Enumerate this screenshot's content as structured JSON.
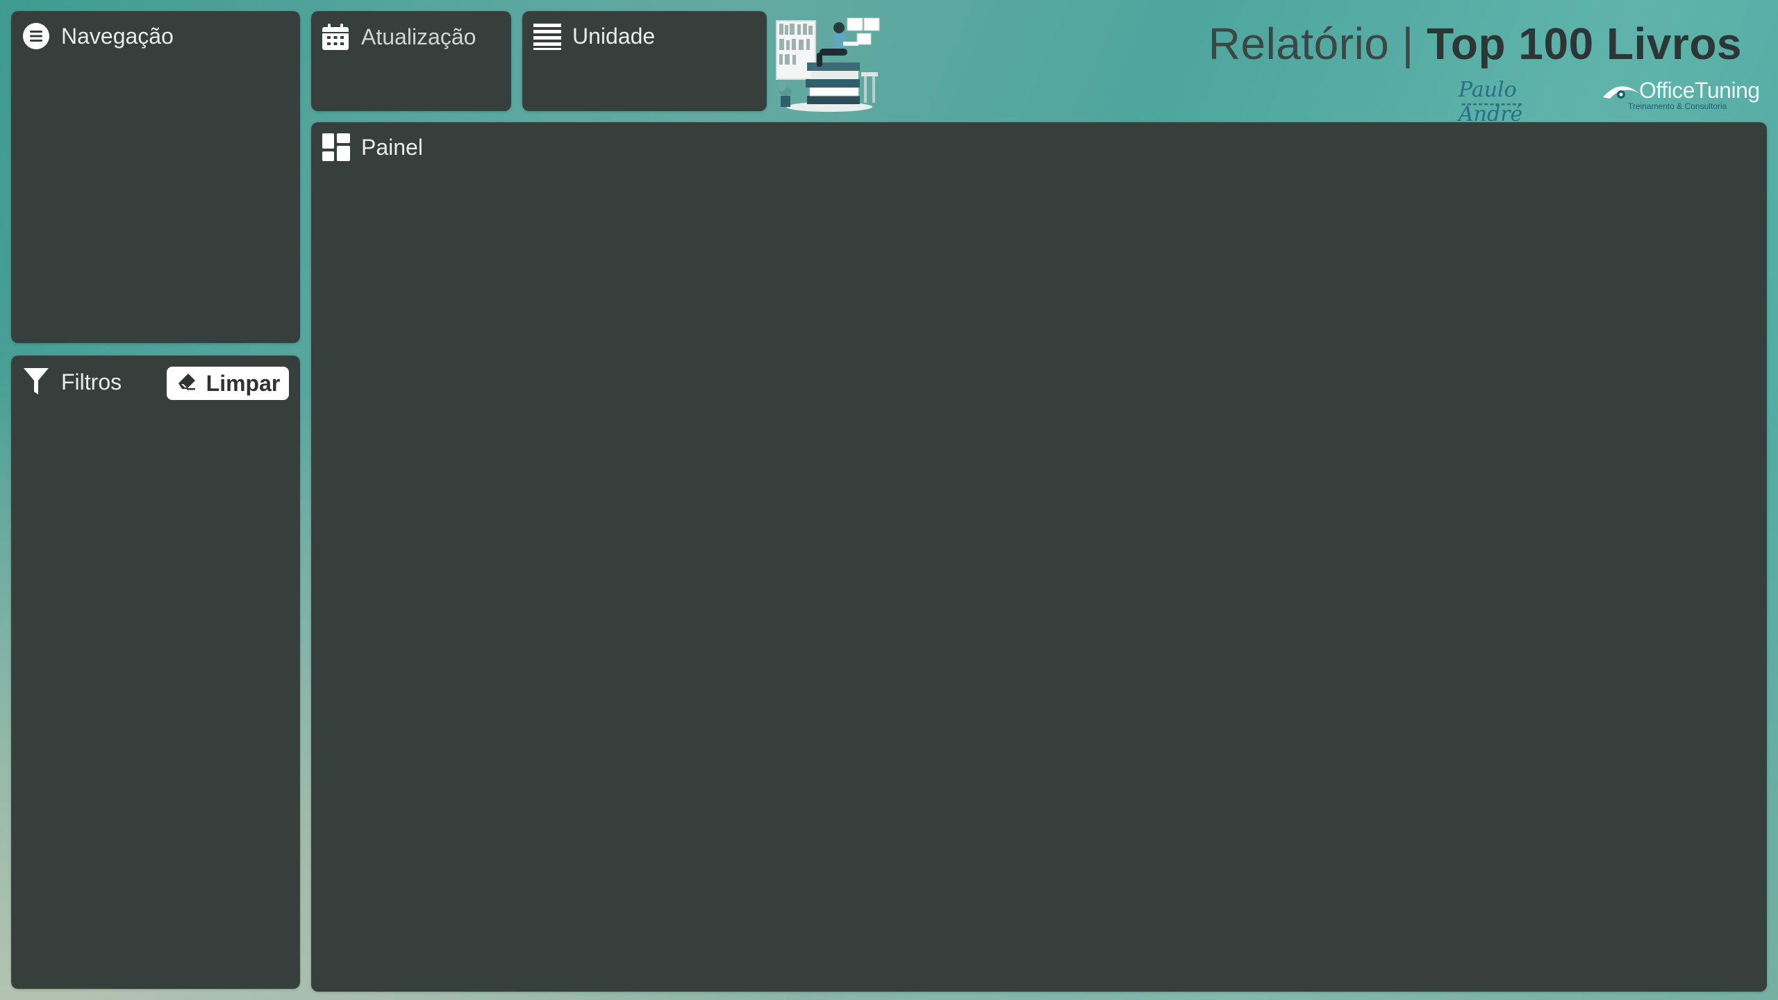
{
  "header": {
    "title_light": "Relatório | ",
    "title_bold": "Top 100 Livros",
    "logos": {
      "paulo_andre": "Paulo André",
      "office_tuning": "OfficeTuning",
      "office_tuning_tagline": "Treinamento & Consultoria"
    }
  },
  "navigation": {
    "label": "Navegação",
    "icon": "menu-circle-icon"
  },
  "filters": {
    "label": "Filtros",
    "icon": "funnel-icon",
    "clear_label": "Limpar",
    "clear_icon": "eraser-icon"
  },
  "update": {
    "label": "Atualização",
    "icon": "calendar-icon"
  },
  "unit": {
    "label": "Unidade",
    "icon": "list-lines-icon"
  },
  "dashboard": {
    "label": "Painel",
    "icon": "dashboard-tiles-icon"
  },
  "colors": {
    "panel": "#363f3c",
    "accent": "#4ea69e",
    "text_light": "#e8ecea"
  }
}
